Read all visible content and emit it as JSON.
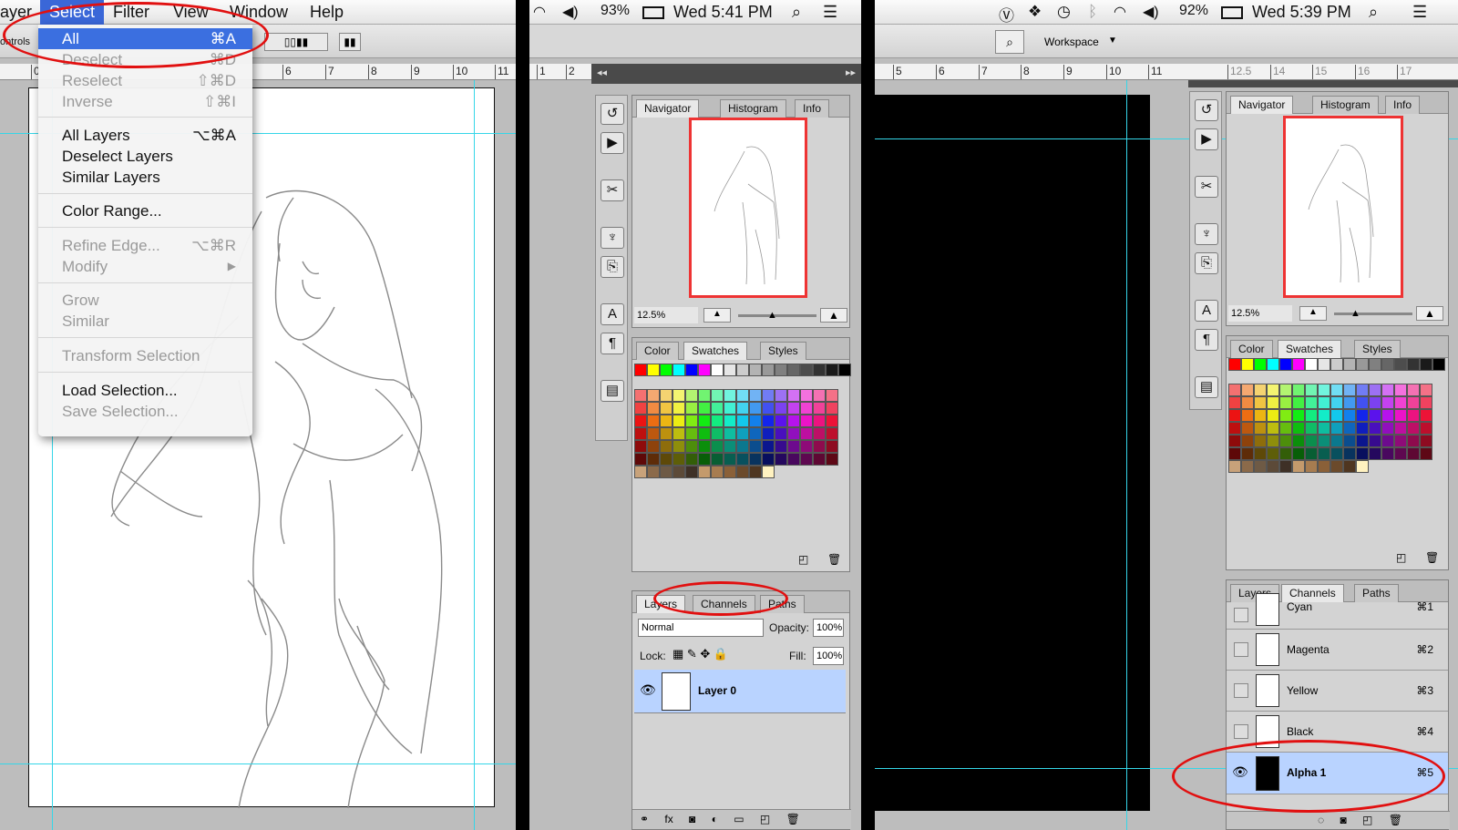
{
  "left": {
    "menubar": {
      "layer": "ayer",
      "select": "Select",
      "filter": "Filter",
      "view": "View",
      "window": "Window",
      "help": "Help"
    },
    "options_label": "ontrols",
    "ruler_ticks": [
      "0",
      "6",
      "7",
      "8",
      "9",
      "10",
      "11"
    ],
    "select_menu": [
      {
        "label": "All",
        "shortcut": "⌘A"
      },
      {
        "label": "Deselect",
        "shortcut": "⌘D"
      },
      {
        "label": "Reselect",
        "shortcut": "⇧⌘D"
      },
      {
        "label": "Inverse",
        "shortcut": "⇧⌘I"
      },
      {
        "label": "All Layers",
        "shortcut": "⌥⌘A"
      },
      {
        "label": "Deselect Layers",
        "shortcut": ""
      },
      {
        "label": "Similar Layers",
        "shortcut": ""
      },
      {
        "label": "Color Range...",
        "shortcut": ""
      },
      {
        "label": "Refine Edge...",
        "shortcut": "⌥⌘R"
      },
      {
        "label": "Modify",
        "shortcut": "▶"
      },
      {
        "label": "Grow",
        "shortcut": ""
      },
      {
        "label": "Similar",
        "shortcut": ""
      },
      {
        "label": "Transform Selection",
        "shortcut": ""
      },
      {
        "label": "Load Selection...",
        "shortcut": ""
      },
      {
        "label": "Save Selection...",
        "shortcut": ""
      }
    ]
  },
  "middle": {
    "status": {
      "battery": "93%",
      "clock": "Wed 5:41 PM"
    },
    "ruler_ticks": [
      "1",
      "2"
    ],
    "navigator": {
      "tabs": [
        "Navigator",
        "Histogram",
        "Info"
      ],
      "zoom": "12.5%"
    },
    "swatches": {
      "tabs": [
        "Color",
        "Swatches",
        "Styles"
      ]
    },
    "layers": {
      "tabs": [
        "Layers",
        "Channels",
        "Paths"
      ],
      "blend_mode": "Normal",
      "opacity_label": "Opacity:",
      "opacity": "100%",
      "lock_label": "Lock:",
      "fill_label": "Fill:",
      "fill": "100%",
      "layer_name": "Layer 0"
    }
  },
  "right": {
    "status": {
      "battery": "92%",
      "clock": "Wed 5:39 PM"
    },
    "workspace_label": "Workspace",
    "ruler_ticks": [
      "5",
      "6",
      "7",
      "8",
      "9",
      "10",
      "11",
      "12.5",
      "14",
      "15",
      "16",
      "17"
    ],
    "navigator": {
      "tabs": [
        "Navigator",
        "Histogram",
        "Info"
      ],
      "zoom": "12.5%"
    },
    "swatches": {
      "tabs": [
        "Color",
        "Swatches",
        "Styles"
      ]
    },
    "channels": {
      "tabs": [
        "Layers",
        "Channels",
        "Paths"
      ],
      "items": [
        {
          "name": "Cyan",
          "shortcut": "⌘1"
        },
        {
          "name": "Magenta",
          "shortcut": "⌘2"
        },
        {
          "name": "Yellow",
          "shortcut": "⌘3"
        },
        {
          "name": "Black",
          "shortcut": "⌘4"
        },
        {
          "name": "Alpha 1",
          "shortcut": "⌘5"
        }
      ]
    }
  },
  "colors": {
    "menu_highlight": "#3b6fe0",
    "annotation_red": "#e11010",
    "guide": "#35d6e8",
    "selected_row": "#b9d3ff"
  }
}
